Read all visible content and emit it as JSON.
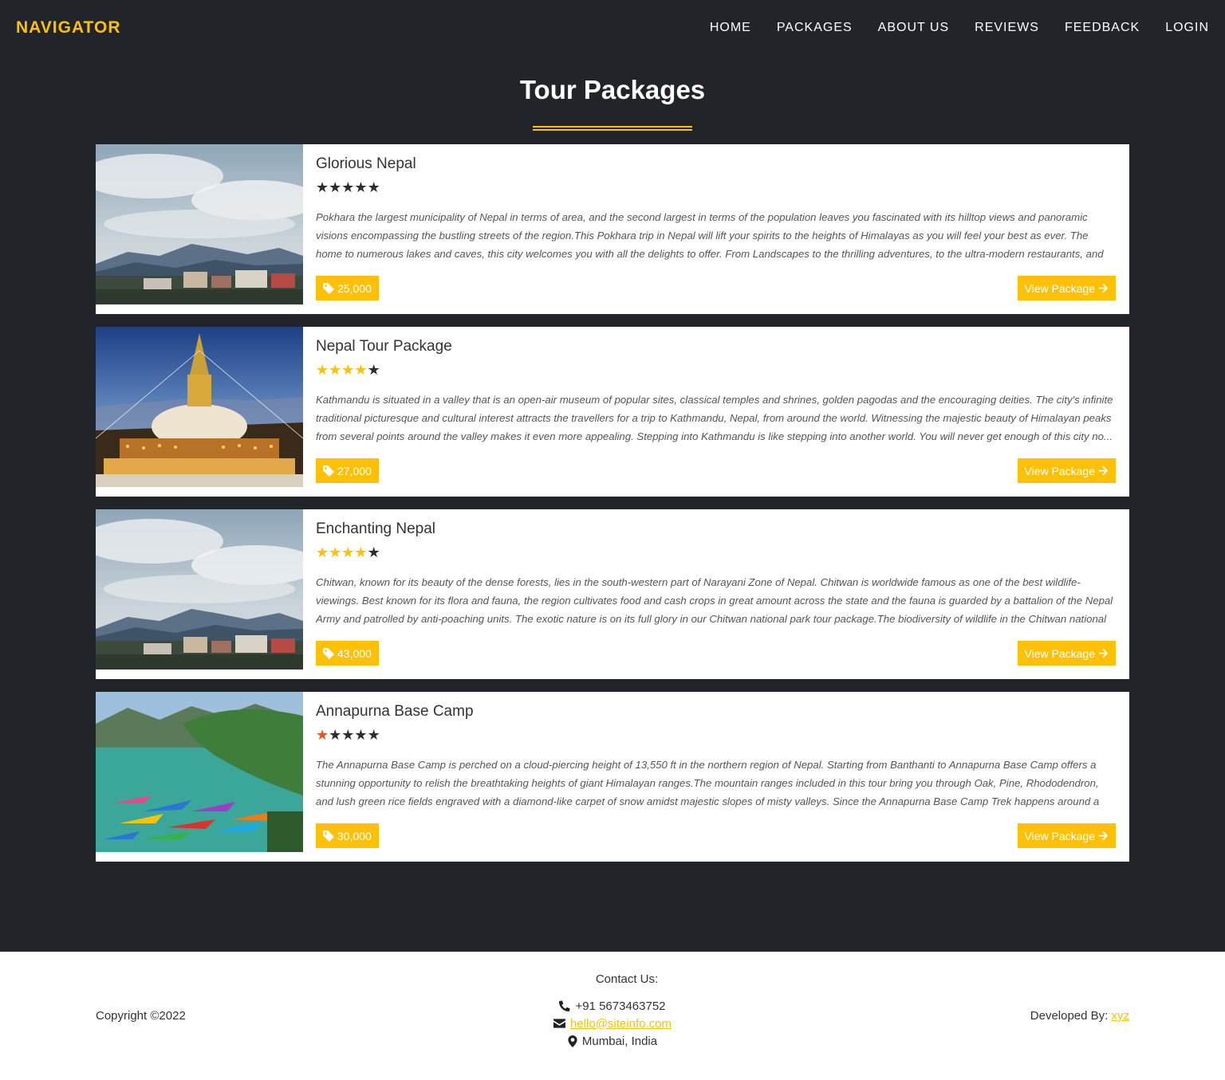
{
  "nav": {
    "brand": "NAVIGATOR",
    "links": [
      "HOME",
      "PACKAGES",
      "ABOUT US",
      "REVIEWS",
      "FEEDBACK",
      "LOGIN"
    ]
  },
  "page_title": "Tour Packages",
  "packages": [
    {
      "title": "Glorious Nepal",
      "rating_colors": [
        "off",
        "off",
        "off",
        "off",
        "off"
      ],
      "description": "Pokhara the largest municipality of Nepal in terms of area, and the second largest in terms of the population leaves you fascinated with its hilltop views and panoramic visions encompassing the bustling streets of the region.This Pokhara trip in Nepal will lift your spirits to the heights of Himalayas as you will feel your best as ever. The home to numerous lakes and caves, this city welcomes you with all the delights to offer. From Landscapes to the thrilling adventures, to the ultra-modern restaurants, and the charmin...",
      "price": "25,000",
      "button": "View Package",
      "image": "mountain-town"
    },
    {
      "title": "Nepal Tour Package",
      "rating_colors": [
        "on",
        "on",
        "on",
        "on",
        "off"
      ],
      "description": "Kathmandu is situated in a valley that is an open-air museum of popular sites, classical temples and shrines, golden pagodas and the encouraging deities. The city's infinite traditional picturesque and cultural interest attracts the travellers for a trip to Kathmandu, Nepal, from around the world. Witnessing the majestic beauty of Himalayan peaks from several points around the valley makes it even more appealing. Stepping into Kathmandu is like stepping into another world. You will never get enough of this city no...",
      "price": "27,000",
      "button": "View Package",
      "image": "stupa"
    },
    {
      "title": "Enchanting Nepal",
      "rating_colors": [
        "on",
        "on",
        "on",
        "on",
        "off"
      ],
      "description": "Chitwan, known for its beauty of the dense forests, lies in the south-western part of Narayani Zone of Nepal. Chitwan is worldwide famous as one of the best wildlife-viewings. Best known for its flora and fauna, the region cultivates food and cash crops in great amount across the state and the fauna is guarded by a battalion of the Nepal Army and patrolled by anti-poaching units. The exotic nature is on its full glory in our Chitwan national park tour package.The biodiversity of wildlife in the Chitwan national park is fa...",
      "price": "43,000",
      "button": "View Package",
      "image": "mountain-town"
    },
    {
      "title": "Annapurna Base Camp",
      "rating_colors": [
        "red",
        "off",
        "off",
        "off",
        "off"
      ],
      "description": "The Annapurna Base Camp is perched on a cloud-piercing height of 13,550 ft in the northern region of Nepal. Starting from Banthanti to Annapurna Base Camp offers a stunning opportunity to relish the breathtaking heights of giant Himalayan ranges.The mountain ranges included in this tour bring you through Oak, Pine, Rhododendron, and lush green rice fields engraved with a diamond-like carpet of snow amidst majestic slopes of misty valleys. Since the Annapurna Base Camp Trek happens around a vast area...",
      "price": "30,000",
      "button": "View Package",
      "image": "lake-boats"
    }
  ],
  "footer": {
    "copyright": "Copyright ©2022",
    "contact_heading": "Contact Us:",
    "phone": "+91 5673463752",
    "email": " hello@siteinfo.com",
    "address": "Mumbai, India",
    "developed_by_label": "Developed By:",
    "developer": "xyz"
  },
  "colors": {
    "accent": "#ffc107",
    "background": "#212529"
  }
}
